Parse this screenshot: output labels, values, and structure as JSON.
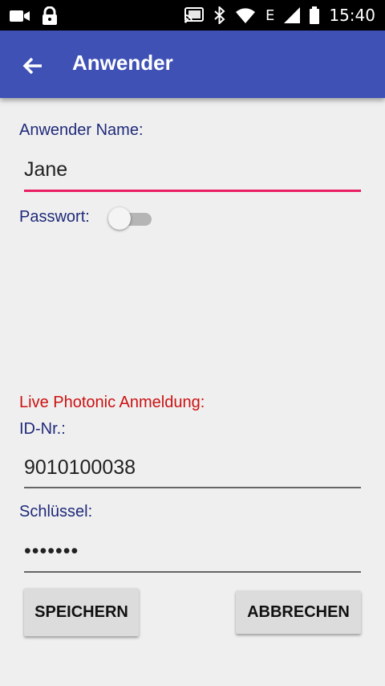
{
  "statusbar": {
    "time": "15:40",
    "network": "E",
    "icons": [
      "video-camera-icon",
      "lock-icon",
      "cast-icon",
      "bluetooth-icon",
      "wifi-icon",
      "signal-icon",
      "battery-icon"
    ]
  },
  "appbar": {
    "title": "Anwender",
    "back_icon": "arrow-back-icon",
    "color": "#3f51b5"
  },
  "form": {
    "username_label": "Anwender Name:",
    "username_value": "Jane",
    "password_label": "Passwort:",
    "password_toggle": false,
    "section_title": "Live Photonic Anmeldung:",
    "id_label": "ID-Nr.:",
    "id_value": "9010100038",
    "key_label": "Schlüssel:",
    "key_value": "•••••••",
    "accent_color": "#e91e63",
    "label_color": "#1f2a7a",
    "section_color": "#cc1111"
  },
  "buttons": {
    "save": "SPEICHERN",
    "cancel": "ABBRECHEN"
  }
}
